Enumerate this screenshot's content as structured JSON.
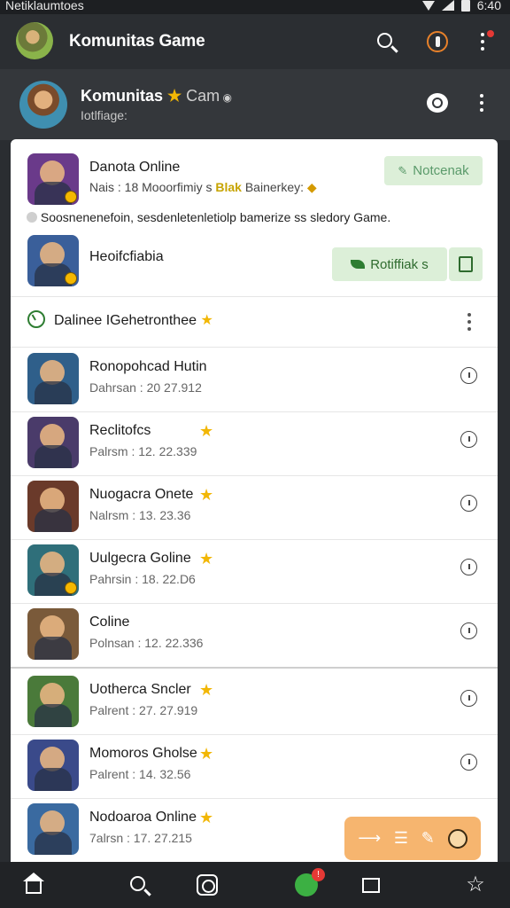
{
  "status_bar": {
    "left_text": "Netiklaumtoes",
    "time": "6:40"
  },
  "app_bar": {
    "title": "Komunitas Game"
  },
  "channel": {
    "title": "Komunitas",
    "title_suffix": "Cam",
    "subtitle": "Iotlfiage:"
  },
  "featured": {
    "name": "Danota Online",
    "meta": "Nais : 18  Mooorfimiy s",
    "meta_highlight": "Blak",
    "meta_tail": "Bainerkey:",
    "button": "Notcenak",
    "description": "Soosnenenefoin, sesdenletenletiolp bamerize ss sledory Game."
  },
  "second": {
    "name": "Heoifcfiabia",
    "button": "Rotiffiak s"
  },
  "section": {
    "title": "Dalinee IGehetronthee"
  },
  "list": [
    {
      "name": "Ronopohcad Hutin",
      "meta": "Dahrsan : 20  27.912",
      "star": false,
      "bg": "#2f5f8a"
    },
    {
      "name": "Reclitofcs",
      "meta": "Palrsm : 12. 22.339",
      "star": true,
      "bg": "#4a3b6a"
    },
    {
      "name": "Nuogacra Onete",
      "meta": "Nalrsm : 13. 23.36",
      "star": true,
      "bg": "#6a3a2a"
    },
    {
      "name": "Uulgecra Goline",
      "meta": "Pahrsin : 18. 22.D6",
      "star": true,
      "bg": "#2f6f7a"
    },
    {
      "name": "Coline",
      "meta": "Polnsan : 12. 22.336",
      "star": false,
      "bg": "#7a5a3a"
    },
    {
      "name": "Uotherca Sncler",
      "meta": "Palrent : 27. 27.919",
      "star": true,
      "bg": "#4a7a3a"
    },
    {
      "name": "Momoros Gholse",
      "meta": "Palrent : 14. 32.56",
      "star": true,
      "bg": "#3a4a8a"
    },
    {
      "name": "Nodoaroa Online",
      "meta": "7alrsn : 17. 27.215",
      "star": true,
      "bg": "#3a6aa0"
    }
  ],
  "bottom_nav": {
    "badge": "!"
  }
}
